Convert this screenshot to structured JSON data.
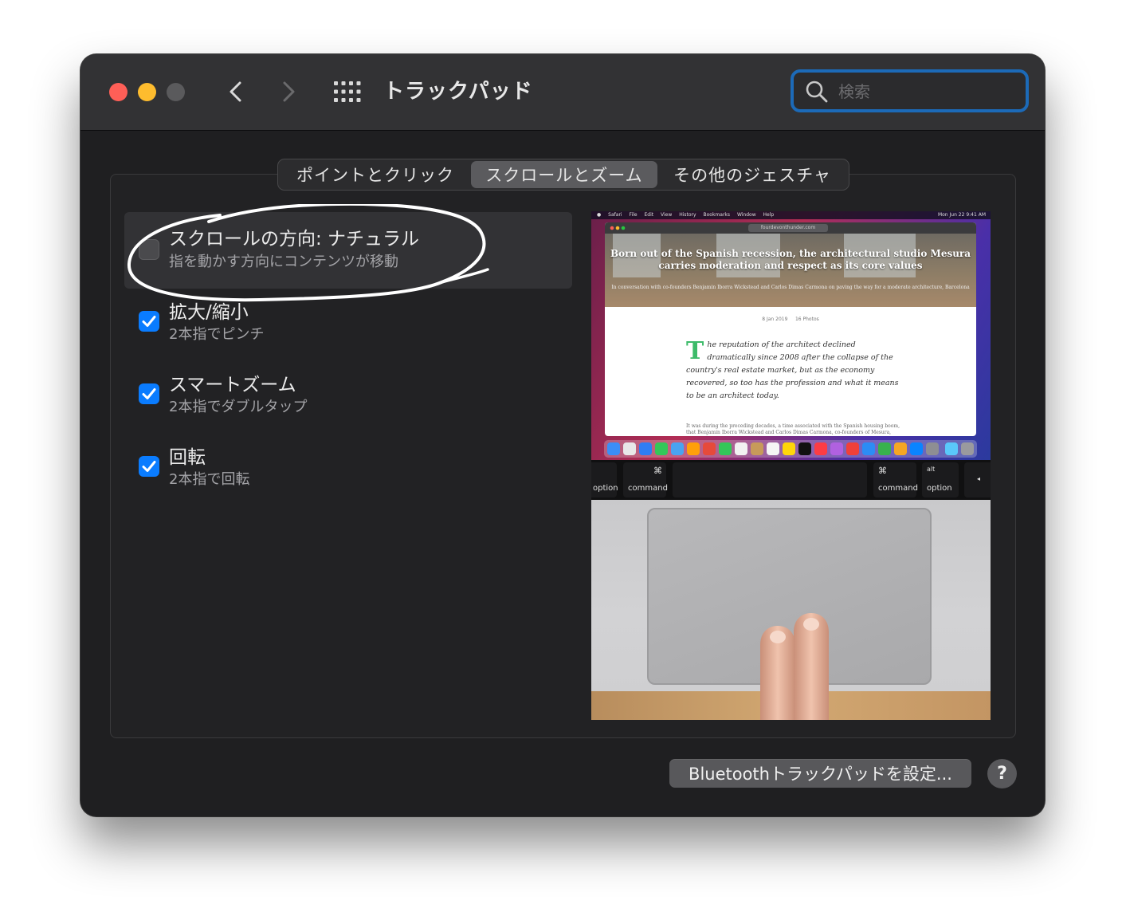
{
  "window": {
    "title": "トラックパッド",
    "search": {
      "placeholder": "検索",
      "value": ""
    }
  },
  "tabs": [
    {
      "label": "ポイントとクリック",
      "selected": false
    },
    {
      "label": "スクロールとズーム",
      "selected": true
    },
    {
      "label": "その他のジェスチャ",
      "selected": false
    }
  ],
  "options": [
    {
      "title": "スクロールの方向: ナチュラル",
      "subtitle": "指を動かす方向にコンテンツが移動",
      "checked": false
    },
    {
      "title": "拡大/縮小",
      "subtitle": "2本指でピンチ",
      "checked": true
    },
    {
      "title": "スマートズーム",
      "subtitle": "2本指でダブルタップ",
      "checked": true
    },
    {
      "title": "回転",
      "subtitle": "2本指で回転",
      "checked": true
    }
  ],
  "preview": {
    "menubar": [
      "Safari",
      "File",
      "Edit",
      "View",
      "History",
      "Bookmarks",
      "Window",
      "Help"
    ],
    "menubar_time": "Mon Jun 22 9:41 AM",
    "url": "fourdevonthunder.com",
    "headline": "Born out of the Spanish recession, the architectural studio Mesura carries moderation and respect as its core values",
    "caption": "In conversation with co-founders Benjamin Iborra Wickstead and Carlos Dimas Carmona on paving the way for a moderate architecture, Barcelona",
    "meta_date": "8 Jan 2019",
    "meta_photos": "16 Photos",
    "dropcap": "T",
    "body": "he reputation of the architect declined dramatically since 2008 after the collapse of the country's real estate market, but as the economy recovered, so too has the profession and what it means to be an architect today.",
    "footer": "It was during the preceding decades, a time associated with the Spanish housing boom, that Benjamin Iborra Wickstead and Carlos Dimas Carmona, co-founders of Mesura,",
    "keys": [
      {
        "top": "",
        "bottom": "option"
      },
      {
        "top": "⌘",
        "bottom": "command"
      },
      {
        "top": "",
        "bottom": ""
      },
      {
        "top": "⌘",
        "bottom": "command"
      },
      {
        "top": "alt",
        "bottom": "option"
      },
      {
        "top": "◂",
        "bottom": ""
      }
    ]
  },
  "buttons": {
    "bluetooth": "Bluetoothトラックパッドを設定...",
    "help": "?"
  },
  "colors": {
    "accent": "#0a7cff",
    "search_focus": "#1c6ab8",
    "close": "#fe5f57",
    "minimize": "#febc2e",
    "dropcap": "#3dbb6a"
  },
  "icons": [
    "back-chevron-icon",
    "forward-chevron-icon",
    "grid-icon",
    "search-icon",
    "checkmark-icon"
  ]
}
